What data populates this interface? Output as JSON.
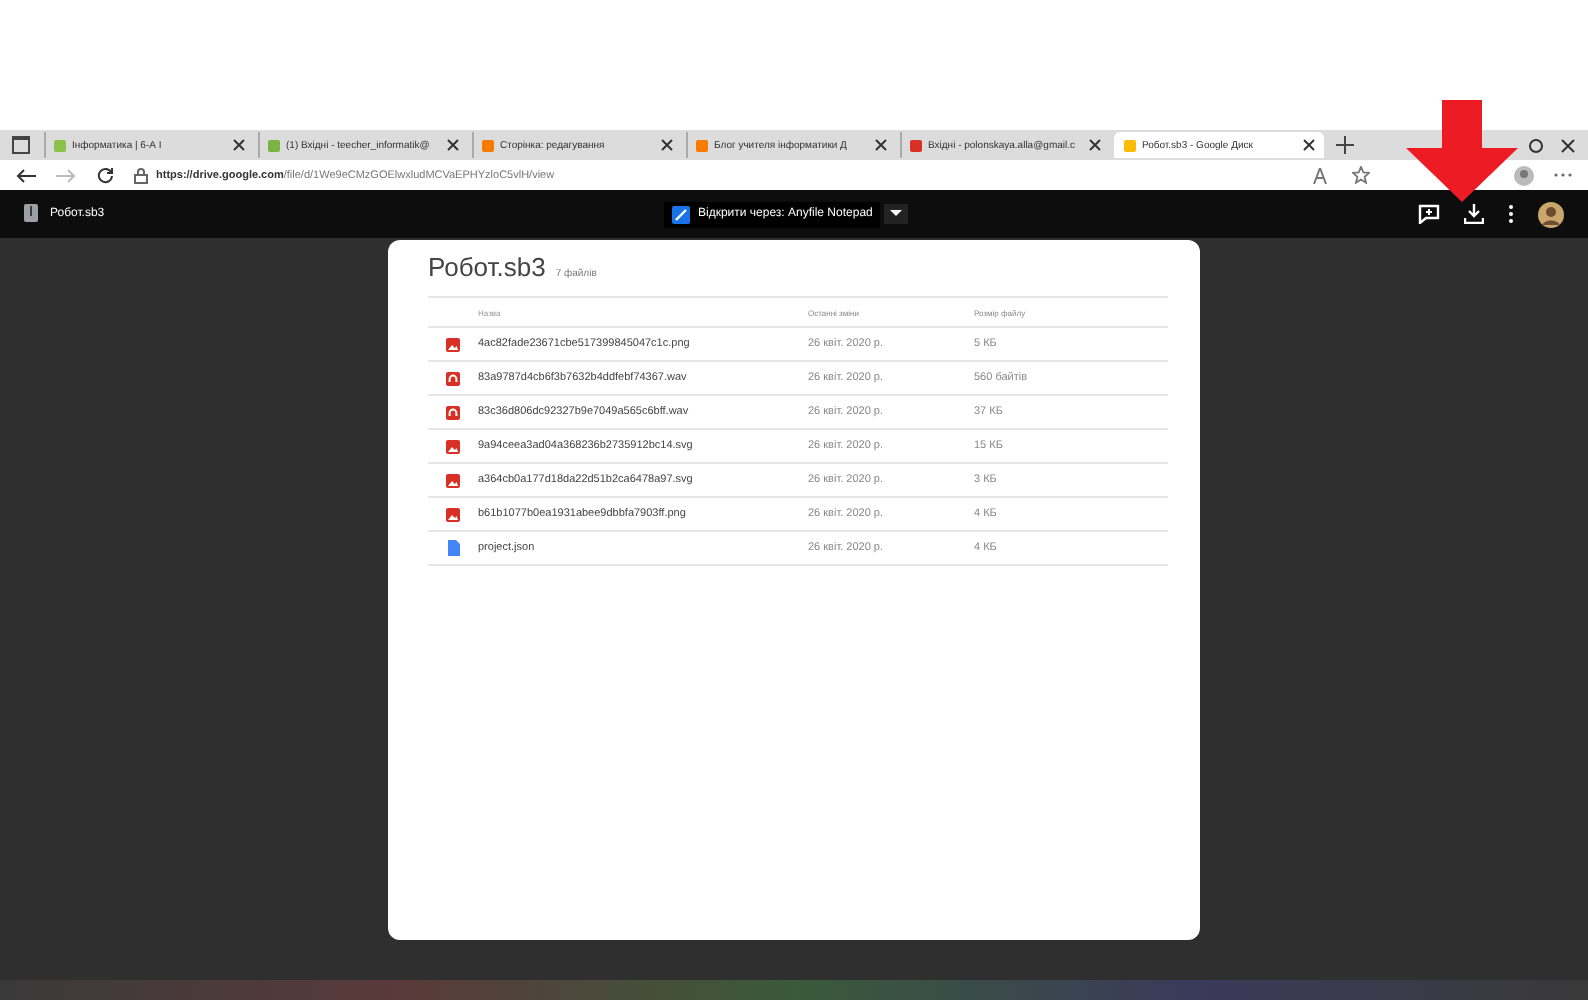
{
  "browser": {
    "tabs": [
      {
        "title": "Інформатика | 6-А І",
        "kind": "puzzle",
        "selected": false
      },
      {
        "title": "(1) Вхідні - teecher_informatik@",
        "kind": "mail",
        "selected": false
      },
      {
        "title": "Сторінка: редагування",
        "kind": "blogger",
        "selected": false
      },
      {
        "title": "Блог учителя інформатики Д",
        "kind": "blogger",
        "selected": false
      },
      {
        "title": "Вхідні - polonskaya.alla@gmail.c",
        "kind": "gmail",
        "selected": false
      },
      {
        "title": "Робот.sb3 - Google Диск",
        "kind": "drive",
        "selected": true
      }
    ],
    "url_host": "https://drive.google.com",
    "url_path": "/file/d/1We9eCMzGOElwxludMCVaEPHYzloC5vlH/view"
  },
  "viewer": {
    "file_name": "Робот.sb3",
    "open_with": "Відкрити через: Anyfile Notepad"
  },
  "archive": {
    "title": "Робот.sb3",
    "count": "7 файлів",
    "columns": [
      "Назва",
      "Останні зміни",
      "Розмір файлу"
    ],
    "rows": [
      {
        "kind": "image",
        "name": "4ac82fade23671cbe517399845047c1c.png",
        "modified": "26 квіт. 2020 р.",
        "size": "5 КБ"
      },
      {
        "kind": "audio",
        "name": "83a9787d4cb6f3b7632b4ddfebf74367.wav",
        "modified": "26 квіт. 2020 р.",
        "size": "560 байтів"
      },
      {
        "kind": "audio",
        "name": "83c36d806dc92327b9e7049a565c6bff.wav",
        "modified": "26 квіт. 2020 р.",
        "size": "37 КБ"
      },
      {
        "kind": "image",
        "name": "9a94ceea3ad04a368236b2735912bc14.svg",
        "modified": "26 квіт. 2020 р.",
        "size": "15 КБ"
      },
      {
        "kind": "image",
        "name": "a364cb0a177d18da22d51b2ca6478a97.svg",
        "modified": "26 квіт. 2020 р.",
        "size": "3 КБ"
      },
      {
        "kind": "image",
        "name": "b61b1077b0ea1931abee9dbbfa7903ff.png",
        "modified": "26 квіт. 2020 р.",
        "size": "4 КБ"
      },
      {
        "kind": "doc",
        "name": "project.json",
        "modified": "26 квіт. 2020 р.",
        "size": "4 КБ"
      }
    ]
  }
}
